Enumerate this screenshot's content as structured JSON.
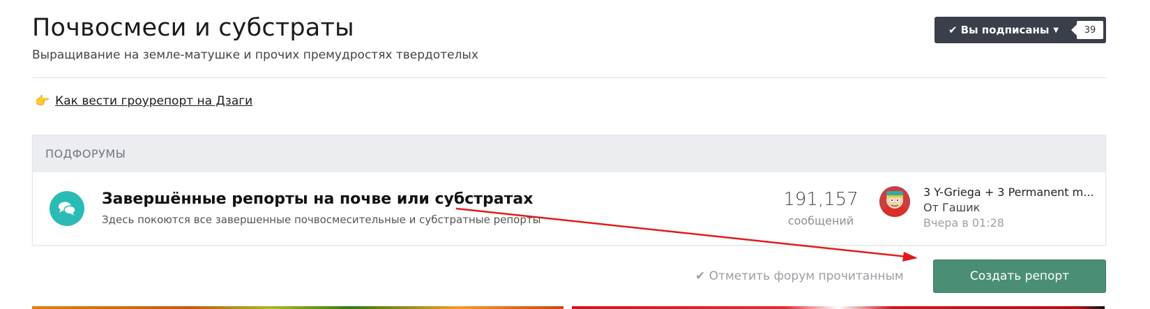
{
  "header": {
    "title": "Почвосмеси и субстраты",
    "subtitle": "Выращивание на земле-матушке и прочих премудростях твердотелых",
    "follow_label": "Вы подписаны",
    "follow_count": "39"
  },
  "guide": {
    "link_text": "Как вести гроурепорт на Дзаги"
  },
  "subforums": {
    "heading": "ПОДФОРУМЫ",
    "items": [
      {
        "title": "Завершённые репорты на почве или субстратах",
        "description": "Здесь покоются все завершенные почвосмесительные и субстратные репорты",
        "posts_count": "191,157",
        "posts_label": "сообщений",
        "last_post_title": "3 Y-Griega + 3 Permanent m...",
        "last_post_author": "От Гашик",
        "last_post_time": "Вчера в 01:28"
      }
    ]
  },
  "actions": {
    "mark_read_label": "Отметить форум прочитанным",
    "create_label": "Создать репорт"
  },
  "colors": {
    "follow_bg": "#3a3f4a",
    "forum_icon": "#2bbbb5",
    "create_button": "#4a8f73",
    "annotation_arrow": "#e11b1b"
  },
  "icons": {
    "follow": "check-icon",
    "follow_dropdown": "caret-down-icon",
    "guide": "pointing-hand-icon",
    "forum": "chat-bubbles-icon",
    "mark_read": "check-icon"
  }
}
